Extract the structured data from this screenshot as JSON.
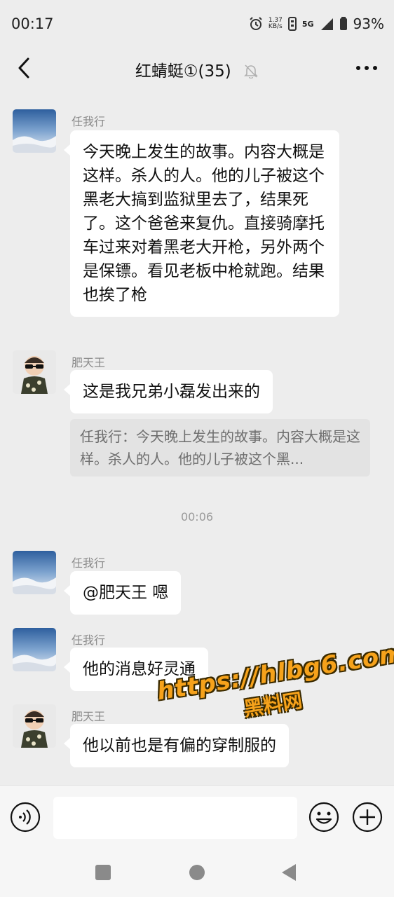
{
  "status_bar": {
    "time": "00:17",
    "net_speed": "1.37",
    "net_unit": "KB/s",
    "network": "5G",
    "battery": "93%"
  },
  "header": {
    "title": "红蜻蜓①(35)"
  },
  "messages": [
    {
      "sender": "任我行",
      "text": "今天晚上发生的故事。内容大概是这样。杀人的人。他的儿子被这个黑老大搞到监狱里去了，结果死了。这个爸爸来复仇。直接骑摩托车过来对着黑老大开枪，另外两个是保镖。看见老板中枪就跑。结果也挨了枪"
    },
    {
      "sender": "肥天王",
      "text": "这是我兄弟小磊发出来的",
      "quote": "任我行：今天晚上发生的故事。内容大概是这样。杀人的人。他的儿子被这个黑..."
    },
    {
      "timestamp": "00:06"
    },
    {
      "sender": "任我行",
      "text": "@肥天王  嗯"
    },
    {
      "sender": "任我行",
      "text": "他的消息好灵通"
    },
    {
      "sender": "肥天王",
      "text": "他以前也是有偏的穿制服的"
    }
  ],
  "watermark": {
    "url": "https://hlbg6.com",
    "label": "黑料网"
  },
  "colors": {
    "background": "#ededed",
    "bubble": "#ffffff",
    "quote_bg": "#e3e3e3",
    "watermark": "#f6a21b"
  }
}
